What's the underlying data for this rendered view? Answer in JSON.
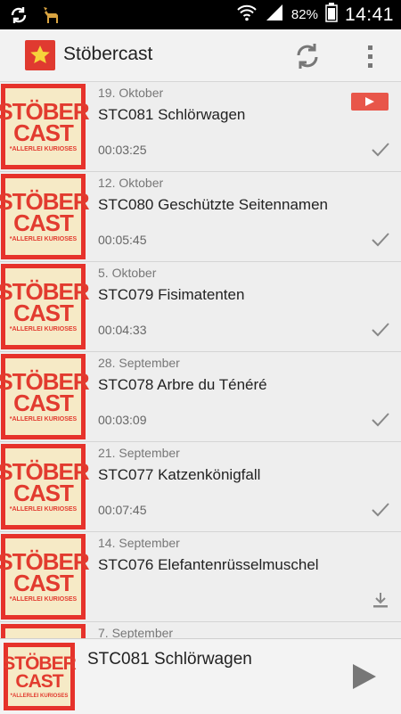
{
  "status_bar": {
    "battery_percent": "82%",
    "clock": "14:41",
    "icons": [
      "sync-icon",
      "deer-icon",
      "wifi-icon",
      "signal-icon",
      "battery-icon"
    ]
  },
  "app_bar": {
    "title": "Stöbercast",
    "actions": [
      "refresh-icon",
      "overflow-menu-icon"
    ]
  },
  "cover_art": {
    "line1": "STÖBER",
    "line2": "CAST",
    "line3": "*ALLERLEI KURIOSES"
  },
  "episodes": [
    {
      "date": "19. Oktober",
      "title": "STC081 Schlörwagen",
      "duration": "00:03:25",
      "status": "played"
    },
    {
      "date": "12. Oktober",
      "title": "STC080 Geschützte Seitennamen",
      "duration": "00:05:45",
      "status": "played"
    },
    {
      "date": "5. Oktober",
      "title": "STC079 Fisimatenten",
      "duration": "00:04:33",
      "status": "played"
    },
    {
      "date": "28. September",
      "title": "STC078 Arbre du Ténéré",
      "duration": "00:03:09",
      "status": "played"
    },
    {
      "date": "21. September",
      "title": "STC077 Katzenkönigfall",
      "duration": "00:07:45",
      "status": "played"
    },
    {
      "date": "14. September",
      "title": "STC076 Elefantenrüsselmuschel",
      "duration": "",
      "status": "download"
    },
    {
      "date": "7. September",
      "title": "",
      "duration": "",
      "status": ""
    }
  ],
  "now_playing": {
    "title": "STC081 Schlörwagen"
  },
  "colors": {
    "accent_red": "#e6322b",
    "cover_bg": "#f6eac6",
    "youtube_badge": "#e8564a"
  }
}
